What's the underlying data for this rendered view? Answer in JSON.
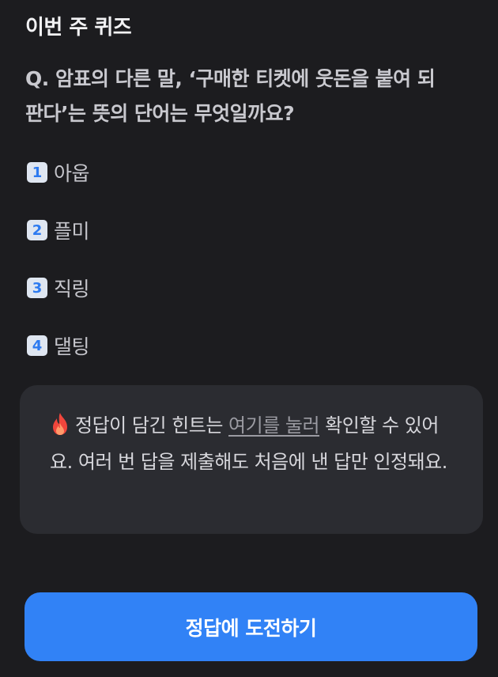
{
  "header": {
    "title": "이번 주 퀴즈"
  },
  "quiz": {
    "question": "Q. 암표의 다른 말, ‘구매한 티켓에 웃돈을 붙여 되판다’는 뜻의 단어는 무엇일까요?",
    "options": [
      {
        "number": "1",
        "label": "아웁"
      },
      {
        "number": "2",
        "label": "플미"
      },
      {
        "number": "3",
        "label": "직링"
      },
      {
        "number": "4",
        "label": "댈팅"
      }
    ]
  },
  "hint": {
    "icon": "fire-icon",
    "text_before": "정답이 담긴 힌트는 ",
    "link_text": "여기를 눌러",
    "text_after": " 확인할 수 있어요. 여러 번 답을 제출해도 처음에 낸 답만 인정돼요."
  },
  "cta": {
    "label": "정답에 도전하기"
  },
  "colors": {
    "background": "#1c1c1f",
    "card": "#2b2c31",
    "accent": "#3182f6",
    "badge_bg": "#dfe6f1"
  }
}
